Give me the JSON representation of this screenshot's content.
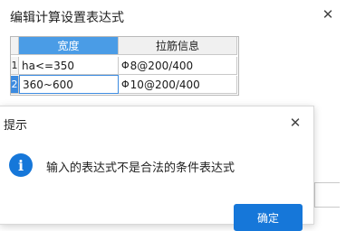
{
  "main_dialog": {
    "title": "编辑计算设置表达式",
    "close_glyph": "✕"
  },
  "grid": {
    "columns": [
      "宽度",
      "拉筋信息"
    ],
    "rows": [
      {
        "num": "1",
        "width": "ha<=350",
        "rebar_symbol": "Φ",
        "rebar": "8@200/400"
      },
      {
        "num": "2",
        "width": "360~600",
        "rebar_symbol": "Φ",
        "rebar": "10@200/400"
      }
    ]
  },
  "alert": {
    "title": "提示",
    "close_glyph": "✕",
    "icon": "info-icon",
    "icon_glyph": "i",
    "message": "输入的表达式不是合法的条件表达式",
    "ok_label": "确定"
  },
  "colors": {
    "accent": "#1677d9",
    "header_selected": "#4a9ce6"
  }
}
